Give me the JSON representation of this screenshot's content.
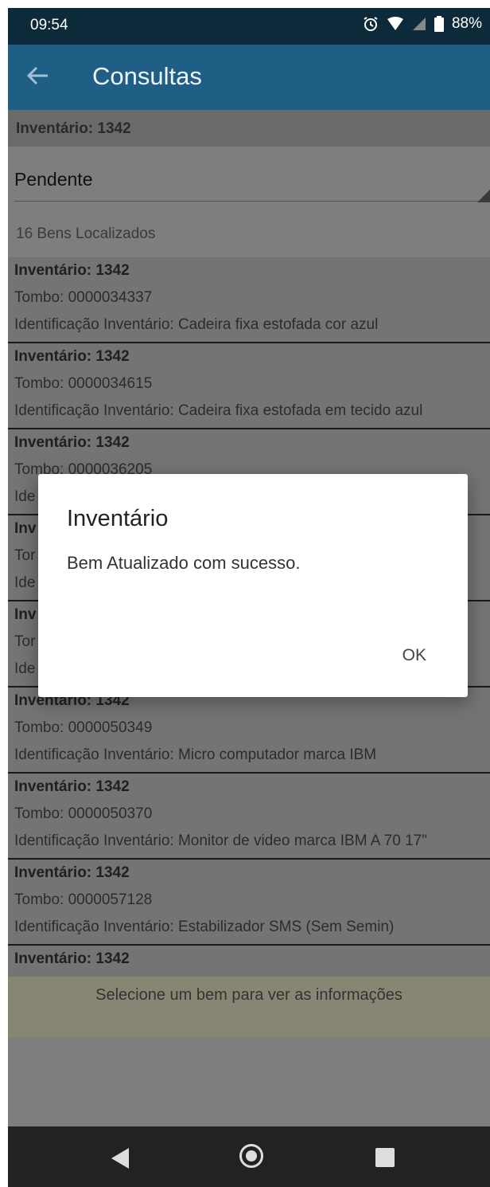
{
  "status": {
    "time": "09:54",
    "battery": "88%"
  },
  "appbar": {
    "title": "Consultas"
  },
  "inventory_header": "Inventário: 1342",
  "filter": {
    "selected": "Pendente"
  },
  "found_count": "16 Bens Localizados",
  "items": [
    {
      "inv": "Inventário: 1342",
      "tombo": "Tombo: 0000034337",
      "ident": "Identificação Inventário: Cadeira fixa estofada cor azul"
    },
    {
      "inv": "Inventário: 1342",
      "tombo": "Tombo: 0000034615",
      "ident": "Identificação Inventário: Cadeira fixa estofada em tecido azul"
    },
    {
      "inv": "Inventário: 1342",
      "tombo": "Tombo: 0000036205",
      "ident": "Ide"
    },
    {
      "inv": "Inv",
      "tombo": "Tor",
      "ident": "Ide"
    },
    {
      "inv": "Inv",
      "tombo": "Tor",
      "ident": "Ide"
    },
    {
      "inv": "Inventário: 1342",
      "tombo": "Tombo: 0000050349",
      "ident": "Identificação Inventário: Micro computador marca IBM"
    },
    {
      "inv": "Inventário: 1342",
      "tombo": "Tombo: 0000050370",
      "ident": "Identificação Inventário: Monitor de video marca IBM A 70 17\""
    },
    {
      "inv": "Inventário: 1342",
      "tombo": "Tombo: 0000057128",
      "ident": "Identificação Inventário: Estabilizador SMS (Sem Semin)"
    }
  ],
  "last_item": {
    "inv": "Inventário: 1342"
  },
  "footer_hint": "Selecione um bem para ver as informações",
  "dialog": {
    "title": "Inventário",
    "message": "Bem Atualizado com sucesso.",
    "ok": "OK"
  }
}
